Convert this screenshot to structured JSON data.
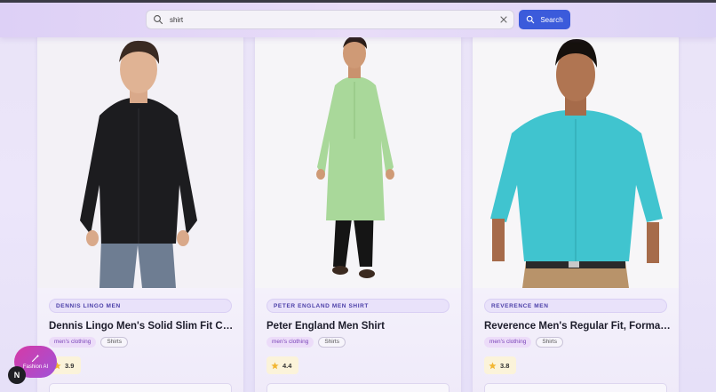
{
  "search": {
    "query": "shirt",
    "button_label": "Search"
  },
  "products": [
    {
      "brand": "DENNIS LINGO MEN",
      "title": "Dennis Lingo Men's Solid Slim Fit Casual Shirt",
      "category": "men's clothing",
      "subcategory": "Shirts",
      "rating": "3.9"
    },
    {
      "brand": "PETER ENGLAND MEN SHIRT",
      "title": "Peter England Men Shirt",
      "category": "men's clothing",
      "subcategory": "Shirts",
      "rating": "4.4"
    },
    {
      "brand": "REVERENCE MEN",
      "title": "Reverence Men's Regular Fit, Formal Shirt",
      "category": "men's clothing",
      "subcategory": "Shirts",
      "rating": "3.8"
    }
  ],
  "fab": {
    "label": "Fashion AI"
  },
  "dev_badge": {
    "label": "N"
  },
  "colors": {
    "accent": "#3b5bdb",
    "fab_gradient_start": "#d63aa6",
    "fab_gradient_end": "#a052d8",
    "star": "#f2b632"
  },
  "icons": {
    "search": "search-icon",
    "clear": "close-icon",
    "fab": "magic-wand-icon",
    "rating": "star-icon"
  }
}
